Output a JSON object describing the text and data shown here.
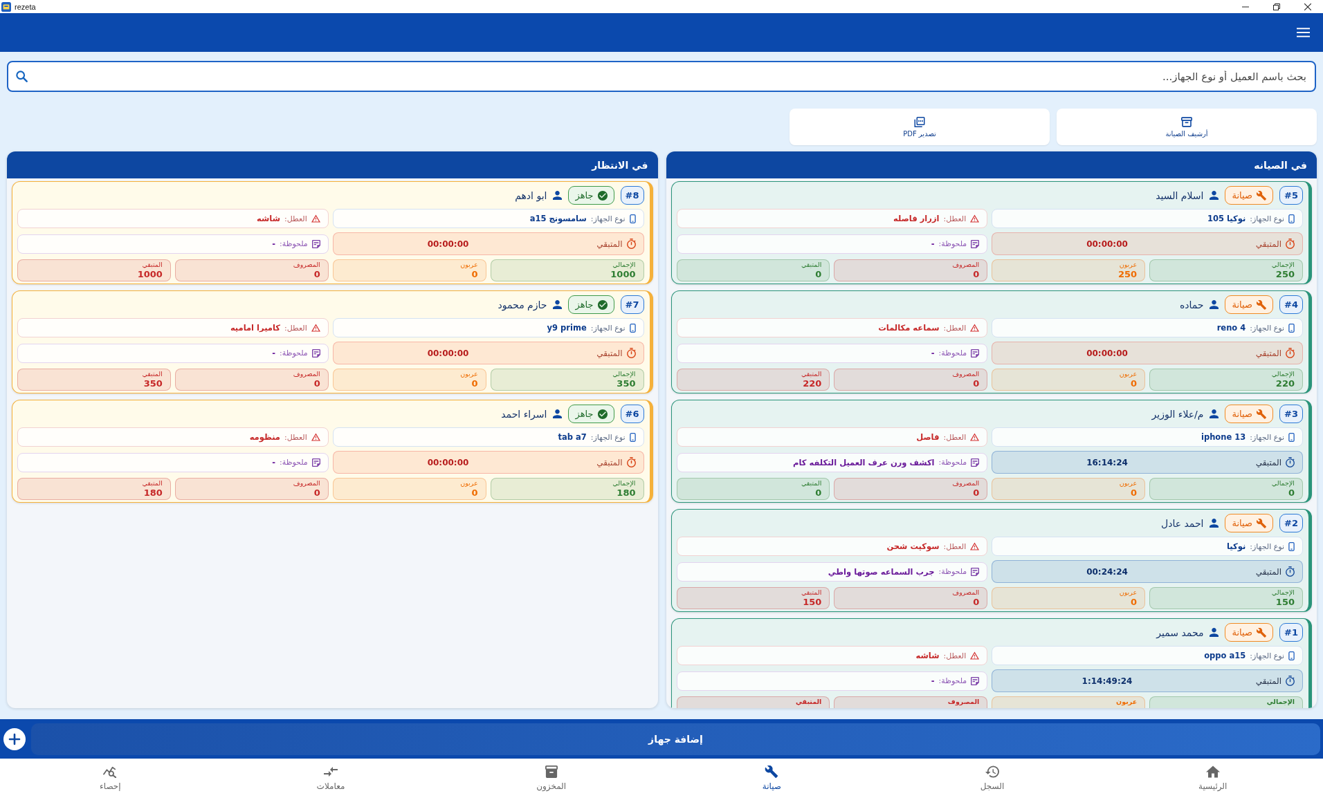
{
  "window": {
    "title": "rezeta"
  },
  "search": {
    "placeholder": "بحث باسم العميل أو نوع الجهاز..."
  },
  "actions": [
    {
      "kind": "archive",
      "label": "أرشيف الصيانة"
    },
    {
      "kind": "pdf",
      "label": "تصدير PDF"
    }
  ],
  "columns": [
    {
      "title": "في الصيانه",
      "cards": [
        {
          "number": "#5",
          "status": {
            "kind": "maintenance",
            "label": "صيانة"
          },
          "customer": "اسلام السيد",
          "device": {
            "label": "نوع الجهاز:",
            "value": "نوكيا 105"
          },
          "fault": {
            "label": "العطل:",
            "value": "ازرار فاصله"
          },
          "timer": {
            "label": "المتبقي",
            "value": "00:00:00",
            "running": false
          },
          "note": {
            "label": "ملحوظة:",
            "value": "-"
          },
          "stats": [
            {
              "label": "الإجمالي",
              "value": "250",
              "color": "#2e7d32"
            },
            {
              "label": "عربون",
              "value": "250",
              "color": "#ef6c00"
            },
            {
              "label": "المصروف",
              "value": "0",
              "color": "#c62828"
            },
            {
              "label": "المتبقي",
              "value": "0",
              "color": "#2e7d32"
            }
          ]
        },
        {
          "number": "#4",
          "status": {
            "kind": "maintenance",
            "label": "صيانة"
          },
          "customer": "حماده",
          "device": {
            "label": "نوع الجهاز:",
            "value": "reno 4"
          },
          "fault": {
            "label": "العطل:",
            "value": "سماعه مكالمات"
          },
          "timer": {
            "label": "المتبقي",
            "value": "00:00:00",
            "running": false
          },
          "note": {
            "label": "ملحوظة:",
            "value": "-"
          },
          "stats": [
            {
              "label": "الإجمالي",
              "value": "220",
              "color": "#2e7d32"
            },
            {
              "label": "عربون",
              "value": "0",
              "color": "#ef6c00"
            },
            {
              "label": "المصروف",
              "value": "0",
              "color": "#c62828"
            },
            {
              "label": "المتبقي",
              "value": "220",
              "color": "#c62828"
            }
          ]
        },
        {
          "number": "#3",
          "status": {
            "kind": "maintenance",
            "label": "صيانة"
          },
          "customer": "م/علاء الوزير",
          "device": {
            "label": "نوع الجهاز:",
            "value": "iphone 13"
          },
          "fault": {
            "label": "العطل:",
            "value": "فاصل"
          },
          "timer": {
            "label": "المتبقي",
            "value": "16:14:24",
            "running": true
          },
          "note": {
            "label": "ملحوظة:",
            "value": "اكشف ورن عرف العميل التكلفه كام"
          },
          "stats": [
            {
              "label": "الإجمالي",
              "value": "0",
              "color": "#2e7d32"
            },
            {
              "label": "عربون",
              "value": "0",
              "color": "#ef6c00"
            },
            {
              "label": "المصروف",
              "value": "0",
              "color": "#c62828"
            },
            {
              "label": "المتبقي",
              "value": "0",
              "color": "#2e7d32"
            }
          ]
        },
        {
          "number": "#2",
          "status": {
            "kind": "maintenance",
            "label": "صيانة"
          },
          "customer": "احمد عادل",
          "device": {
            "label": "نوع الجهاز:",
            "value": "نوكيا"
          },
          "fault": {
            "label": "العطل:",
            "value": "سوكيت شحن"
          },
          "timer": {
            "label": "المتبقي",
            "value": "00:24:24",
            "running": true
          },
          "note": {
            "label": "ملحوظة:",
            "value": "جرب السماعه صوتها واطي"
          },
          "stats": [
            {
              "label": "الإجمالي",
              "value": "150",
              "color": "#2e7d32"
            },
            {
              "label": "عربون",
              "value": "0",
              "color": "#ef6c00"
            },
            {
              "label": "المصروف",
              "value": "0",
              "color": "#c62828"
            },
            {
              "label": "المتبقي",
              "value": "150",
              "color": "#c62828"
            }
          ]
        },
        {
          "number": "#1",
          "status": {
            "kind": "maintenance",
            "label": "صيانة"
          },
          "customer": "محمد سمير",
          "device": {
            "label": "نوع الجهاز:",
            "value": "oppo a15"
          },
          "fault": {
            "label": "العطل:",
            "value": "شاشه"
          },
          "timer": {
            "label": "المتبقي",
            "value": "1:14:49:24",
            "running": true
          },
          "note": {
            "label": "ملحوظة:",
            "value": "-"
          },
          "stats": [
            {
              "label": "الإجمالي",
              "color": "#2e7d32"
            },
            {
              "label": "عربون",
              "color": "#ef6c00"
            },
            {
              "label": "المصروف",
              "color": "#c62828"
            },
            {
              "label": "المتبقي",
              "color": "#c62828"
            }
          ]
        }
      ]
    },
    {
      "title": "في الانتظار",
      "cards": [
        {
          "number": "#8",
          "status": {
            "kind": "ready",
            "label": "جاهز"
          },
          "customer": "ابو ادهم",
          "device": {
            "label": "نوع الجهاز:",
            "value": "سامسونج a15"
          },
          "fault": {
            "label": "العطل:",
            "value": "شاشه"
          },
          "timer": {
            "label": "المتبقي",
            "value": "00:00:00",
            "running": false
          },
          "note": {
            "label": "ملحوظة:",
            "value": "-"
          },
          "stats": [
            {
              "label": "الإجمالي",
              "value": "1000",
              "color": "#2e7d32"
            },
            {
              "label": "عربون",
              "value": "0",
              "color": "#ef6c00"
            },
            {
              "label": "المصروف",
              "value": "0",
              "color": "#c62828"
            },
            {
              "label": "المتبقي",
              "value": "1000",
              "color": "#c62828"
            }
          ]
        },
        {
          "number": "#7",
          "status": {
            "kind": "ready",
            "label": "جاهز"
          },
          "customer": "حازم محمود",
          "device": {
            "label": "نوع الجهاز:",
            "value": "y9 prime"
          },
          "fault": {
            "label": "العطل:",
            "value": "كاميرا اماميه"
          },
          "timer": {
            "label": "المتبقي",
            "value": "00:00:00",
            "running": false
          },
          "note": {
            "label": "ملحوظة:",
            "value": "-"
          },
          "stats": [
            {
              "label": "الإجمالي",
              "value": "350",
              "color": "#2e7d32"
            },
            {
              "label": "عربون",
              "value": "0",
              "color": "#ef6c00"
            },
            {
              "label": "المصروف",
              "value": "0",
              "color": "#c62828"
            },
            {
              "label": "المتبقي",
              "value": "350",
              "color": "#c62828"
            }
          ]
        },
        {
          "number": "#6",
          "status": {
            "kind": "ready",
            "label": "جاهز"
          },
          "customer": "اسراء احمد",
          "device": {
            "label": "نوع الجهاز:",
            "value": "tab a7"
          },
          "fault": {
            "label": "العطل:",
            "value": "منظومه"
          },
          "timer": {
            "label": "المتبقي",
            "value": "00:00:00",
            "running": false
          },
          "note": {
            "label": "ملحوظة:",
            "value": "-"
          },
          "stats": [
            {
              "label": "الإجمالي",
              "value": "180",
              "color": "#2e7d32"
            },
            {
              "label": "عربون",
              "value": "0",
              "color": "#ef6c00"
            },
            {
              "label": "المصروف",
              "value": "0",
              "color": "#c62828"
            },
            {
              "label": "المتبقي",
              "value": "180",
              "color": "#c62828"
            }
          ]
        }
      ]
    }
  ],
  "add_button": {
    "label": "إضافة جهاز"
  },
  "nav": [
    {
      "kind": "home",
      "label": "الرئيسية",
      "selected": false
    },
    {
      "kind": "history",
      "label": "السجل",
      "selected": false
    },
    {
      "kind": "maintenance",
      "label": "صيانة",
      "selected": true
    },
    {
      "kind": "inventory",
      "label": "المخزون",
      "selected": false
    },
    {
      "kind": "transactions",
      "label": "معاملات",
      "selected": false
    },
    {
      "kind": "stats",
      "label": "إحصاء",
      "selected": false
    }
  ]
}
